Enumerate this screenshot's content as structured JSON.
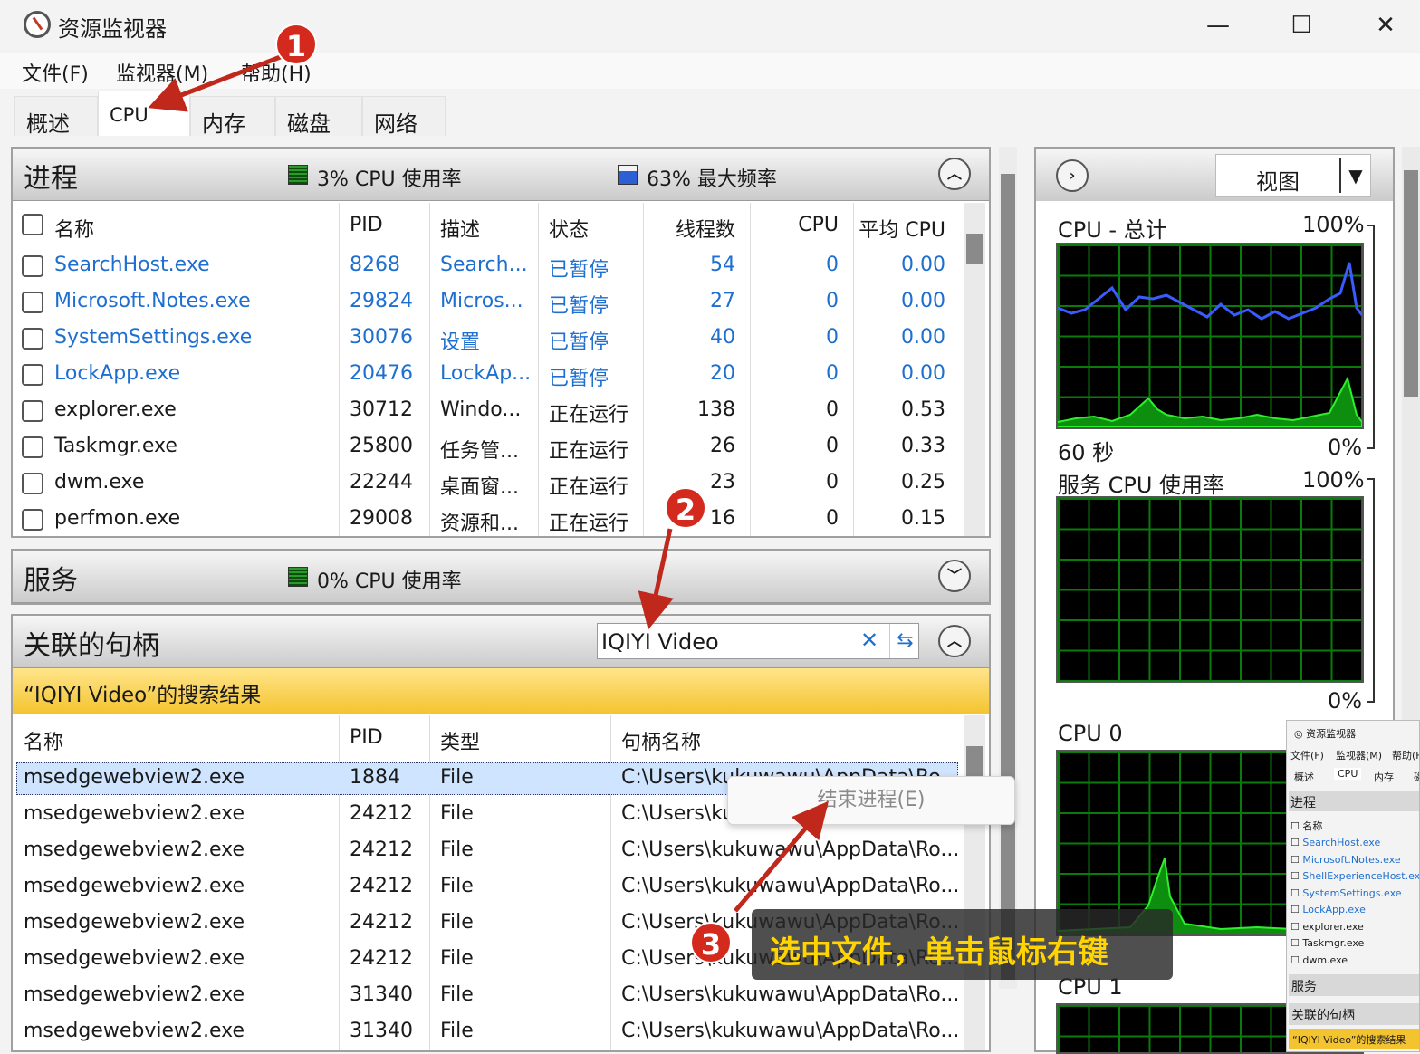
{
  "window": {
    "title": "资源监视器",
    "minimize": "—",
    "maximize": "☐",
    "close": "✕"
  },
  "menu": [
    "文件(F)",
    "监视器(M)",
    "帮助(H)"
  ],
  "tabs": [
    "概述",
    "CPU",
    "内存",
    "磁盘",
    "网络"
  ],
  "process": {
    "title": "进程",
    "cpu_stat": "3% CPU 使用率",
    "freq_stat": "63% 最大频率",
    "headers": [
      "名称",
      "PID",
      "描述",
      "状态",
      "线程数",
      "CPU",
      "平均 CPU"
    ],
    "rows": [
      [
        "SearchHost.exe",
        "8268",
        "Search...",
        "已暂停",
        "54",
        "0",
        "0.00"
      ],
      [
        "Microsoft.Notes.exe",
        "29824",
        "Micros...",
        "已暂停",
        "27",
        "0",
        "0.00"
      ],
      [
        "SystemSettings.exe",
        "30076",
        "设置",
        "已暂停",
        "40",
        "0",
        "0.00"
      ],
      [
        "LockApp.exe",
        "20476",
        "LockAp...",
        "已暂停",
        "20",
        "0",
        "0.00"
      ],
      [
        "explorer.exe",
        "30712",
        "Windo...",
        "正在运行",
        "138",
        "0",
        "0.53"
      ],
      [
        "Taskmgr.exe",
        "25800",
        "任务管...",
        "正在运行",
        "26",
        "0",
        "0.33"
      ],
      [
        "dwm.exe",
        "22244",
        "桌面窗...",
        "正在运行",
        "23",
        "0",
        "0.25"
      ],
      [
        "perfmon.exe",
        "29008",
        "资源和...",
        "正在运行",
        "16",
        "0",
        "0.15"
      ]
    ]
  },
  "services": {
    "title": "服务",
    "cpu_stat": "0% CPU 使用率"
  },
  "handles": {
    "title": "关联的句柄",
    "search_value": "IQIYI Video",
    "banner": "“IQIYI Video”的搜索结果",
    "headers": [
      "名称",
      "PID",
      "类型",
      "句柄名称"
    ],
    "rows": [
      [
        "msedgewebview2.exe",
        "1884",
        "File",
        "C:\\Users\\kukuwawu\\AppData\\Ro..."
      ],
      [
        "msedgewebview2.exe",
        "24212",
        "File",
        "C:\\Users\\ku"
      ],
      [
        "msedgewebview2.exe",
        "24212",
        "File",
        "C:\\Users\\kukuwawu\\AppData\\Ro..."
      ],
      [
        "msedgewebview2.exe",
        "24212",
        "File",
        "C:\\Users\\kukuwawu\\AppData\\Ro..."
      ],
      [
        "msedgewebview2.exe",
        "24212",
        "File",
        "C:\\Users\\kukuwawu\\AppData\\Ro..."
      ],
      [
        "msedgewebview2.exe",
        "24212",
        "File",
        "C:\\Users\\kukuwawu\\AppData\\Ro..."
      ],
      [
        "msedgewebview2.exe",
        "31340",
        "File",
        "C:\\Users\\kukuwawu\\AppData\\Ro..."
      ],
      [
        "msedgewebview2.exe",
        "31340",
        "File",
        "C:\\Users\\kukuwawu\\AppData\\Ro..."
      ]
    ]
  },
  "context_menu": {
    "end_process": "结束进程(E)"
  },
  "right_panel": {
    "view_label": "视图",
    "cpu_total": {
      "label": "CPU - 总计",
      "max": "100%",
      "time": "60 秒",
      "min": "0%"
    },
    "service_cpu": {
      "label": "服务 CPU 使用率",
      "max": "100%",
      "min": "0%"
    },
    "cpu0": "CPU 0",
    "cpu1": "CPU 1"
  },
  "annotations": {
    "step1": "1",
    "step2": "2",
    "step3": "3",
    "caption": "选中文件，单击鼠标右键"
  },
  "mini": {
    "title": "资源监视器",
    "menu": [
      "文件(F)",
      "监视器(M)",
      "帮助(H"
    ],
    "tabs": [
      "概述",
      "CPU",
      "内存",
      "磁"
    ],
    "process": "进程",
    "name_col": "名称",
    "items": [
      "SearchHost.exe",
      "Microsoft.Notes.exe",
      "ShellExperienceHost.exe",
      "SystemSettings.exe",
      "LockApp.exe",
      "explorer.exe",
      "Taskmgr.exe",
      "dwm.exe"
    ],
    "services": "服务",
    "handles": "关联的句柄",
    "banner": "“IQIYI Video”的搜索结果"
  },
  "colors": {
    "link_blue": "#1e6fd0",
    "graph_green": "#0a7a0a",
    "highlight": "#f4c430",
    "badge": "#d42a1e"
  }
}
